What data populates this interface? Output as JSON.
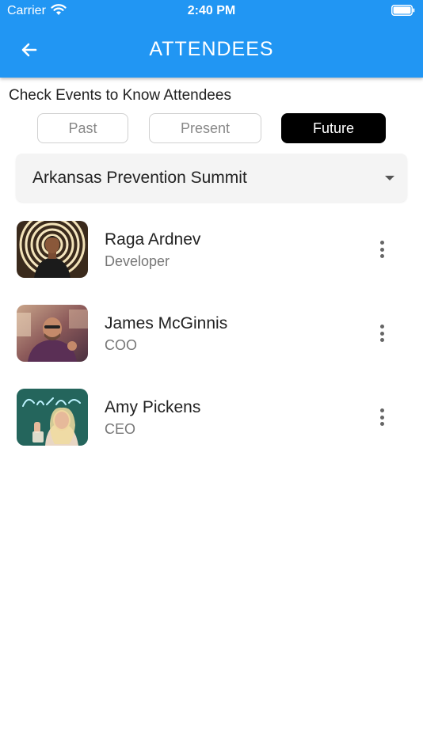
{
  "status_bar": {
    "carrier": "Carrier",
    "time": "2:40 PM"
  },
  "header": {
    "title": "ATTENDEES",
    "back_icon": "arrow-left-icon"
  },
  "subtitle": "Check Events to Know Attendees",
  "segments": [
    {
      "label": "Past",
      "selected": false
    },
    {
      "label": "Present",
      "selected": false
    },
    {
      "label": "Future",
      "selected": true
    }
  ],
  "event_dropdown": {
    "value": "Arkansas Prevention Summit"
  },
  "attendees": [
    {
      "name": "Raga Ardnev",
      "role": "Developer",
      "avatar": "person-photo"
    },
    {
      "name": "James McGinnis",
      "role": "COO",
      "avatar": "person-photo"
    },
    {
      "name": "Amy Pickens",
      "role": "CEO",
      "avatar": "person-photo"
    }
  ],
  "colors": {
    "app_bar": "#2196F3",
    "selected_segment": "#000000"
  }
}
